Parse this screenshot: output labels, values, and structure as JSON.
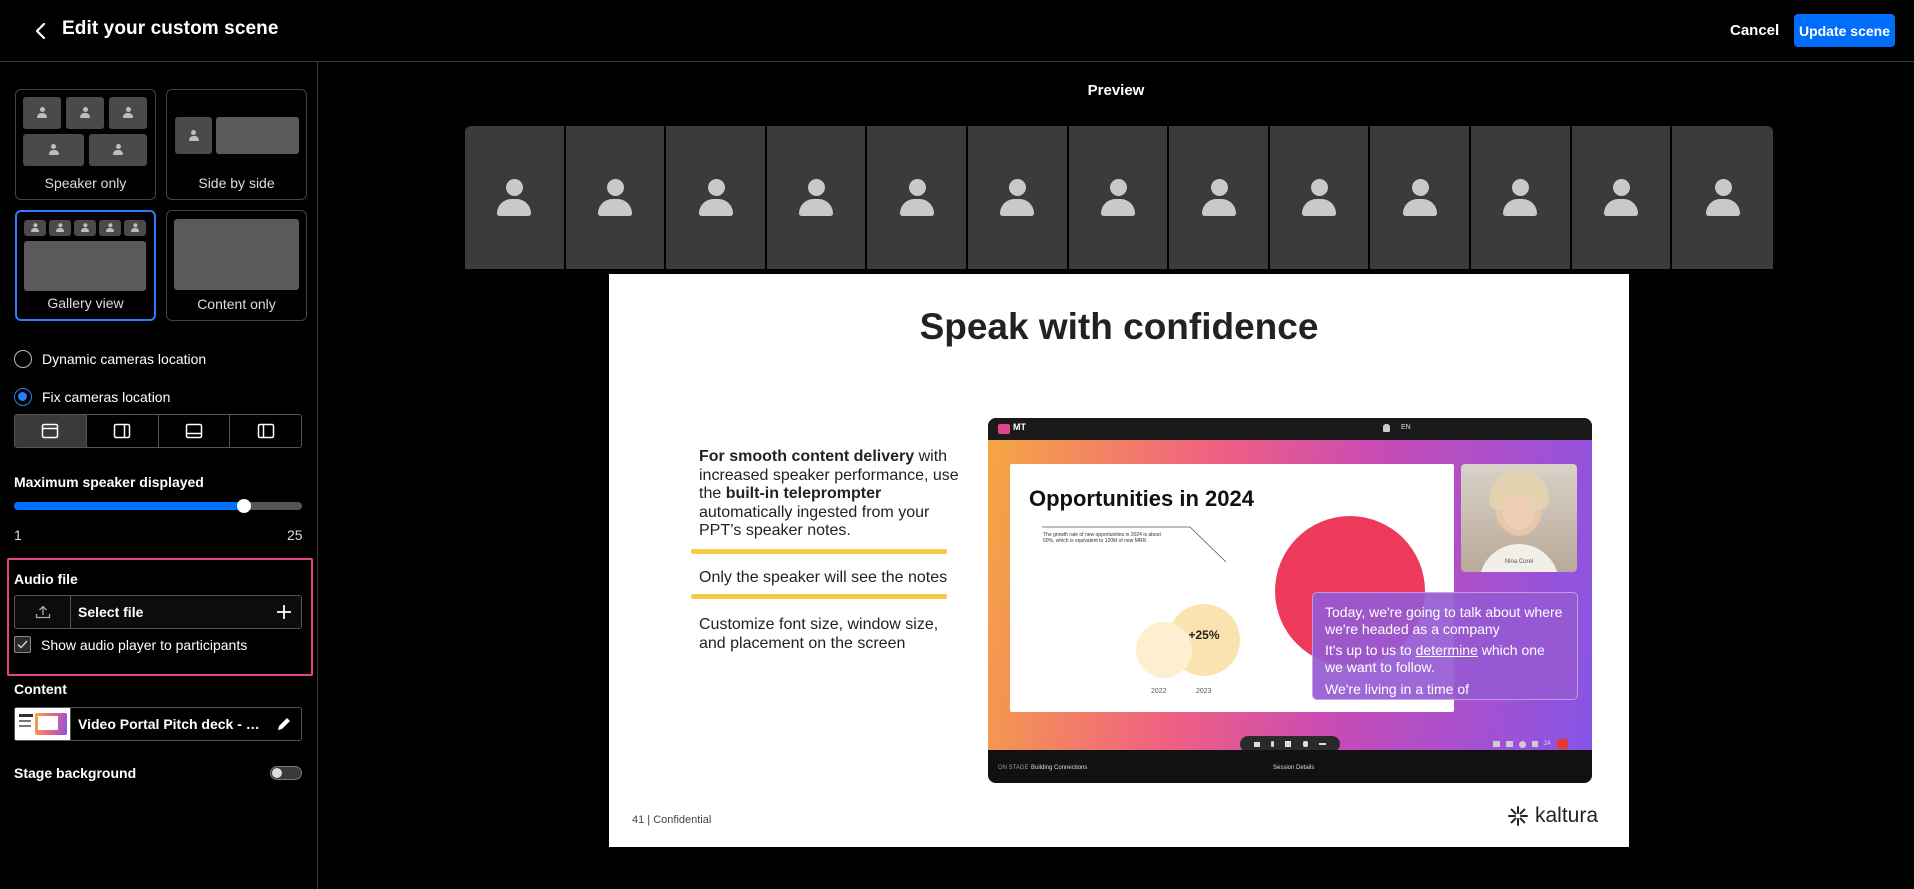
{
  "header": {
    "title": "Edit your custom scene",
    "cancel_label": "Cancel",
    "update_label": "Update scene"
  },
  "layouts": [
    {
      "label": "Speaker only",
      "selected": false
    },
    {
      "label": "Side by side",
      "selected": false
    },
    {
      "label": "Gallery view",
      "selected": true
    },
    {
      "label": "Content only",
      "selected": false
    }
  ],
  "camera_location": {
    "dynamic_label": "Dynamic cameras location",
    "fix_label": "Fix cameras location",
    "selected": "fix",
    "positions": [
      "top",
      "right",
      "bottom",
      "left"
    ],
    "active_position": "top"
  },
  "max_speaker": {
    "label": "Maximum speaker displayed",
    "min": "1",
    "max": "25",
    "value_fraction": 0.8
  },
  "audio": {
    "title": "Audio file",
    "select_label": "Select file",
    "show_player_label": "Show audio player to participants",
    "show_player_checked": true
  },
  "content": {
    "title": "Content",
    "file_name": "Video Portal Pitch deck - Ma..."
  },
  "stage_background": {
    "label": "Stage background",
    "on": false
  },
  "preview": {
    "title": "Preview",
    "camera_tiles": 13,
    "slide": {
      "title": "Speak with confidence",
      "p1_bold_a": "For smooth content delivery",
      "p1_a": " with increased speaker performance, use the ",
      "p1_bold_b": "built-in teleprompter",
      "p1_b": " automatically ingested from your PPT’s speaker notes.",
      "p2": "Only the speaker will see the notes",
      "p3": "Customize font size, window size, and placement on the screen",
      "footer": "41 | Confidential",
      "logo_text": "kaltura",
      "screenshot": {
        "brand": "MT",
        "lang": "EN",
        "inner_title": "Opportunities in 2024",
        "inner_note": "The growth rate of new opportunities in 2024 is about 50%, which is equivalent to 120M of new MRR.",
        "bubble_label": "+25%",
        "year_a": "2022",
        "year_b": "2023",
        "presenter_name": "Nina Corel",
        "prompter_line1": "Today, we're going to talk about where we're headed as a company",
        "prompter_line2_a": "It's up to us to ",
        "prompter_line2_link": "determine",
        "prompter_line2_b": " which one we want to follow.",
        "prompter_line3": "We're living in a time of",
        "stage_label": "ON STAGE",
        "stage_session": "Building Connections",
        "session_details": "Session Details",
        "participant_count": "24"
      }
    }
  },
  "colors": {
    "accent": "#006efa",
    "highlight_border": "#e6438e",
    "yellow_line": "#f7c948"
  }
}
